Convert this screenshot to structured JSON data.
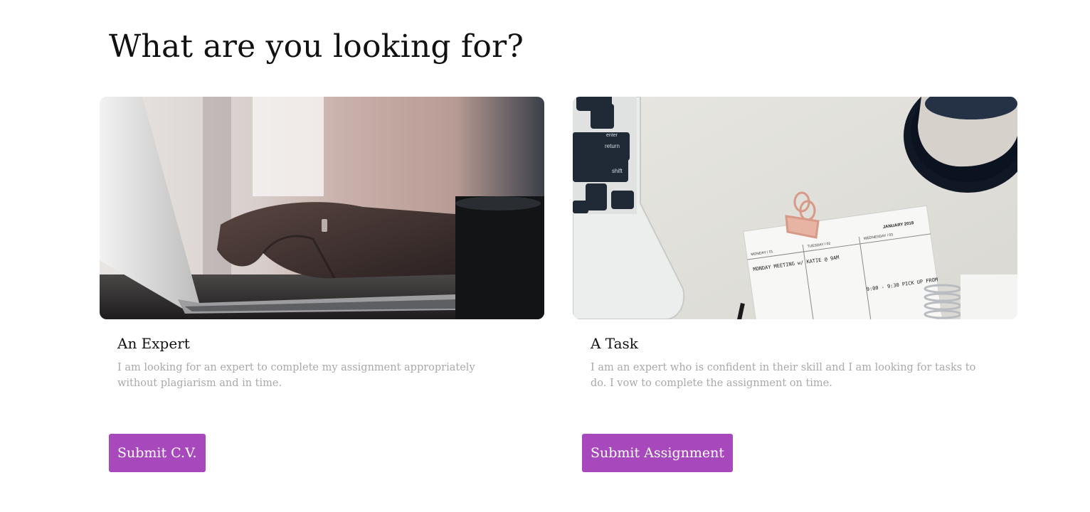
{
  "heading": "What are you looking for?",
  "cards": [
    {
      "title": "An Expert",
      "description": "I am looking for an expert to complete my assignment appropriately without plagiarism and in time.",
      "button_label": "Submit C.V."
    },
    {
      "title": "A Task",
      "description": "I am an expert who is confident in their skill and I am looking for tasks to do. I vow to complete the assignment on time.",
      "button_label": "Submit Assignment",
      "photo_text": {
        "key_enter": "enter",
        "key_return": "return",
        "key_shift": "shift",
        "planner_day_1": "MONDAY / 01",
        "planner_day_2": "TUESDAY / 02",
        "planner_day_3": "WEDNESDAY / 03",
        "planner_month": "JANUARY 2018",
        "note_1": "MONDAY MEETING w/ KATIE @ 9AM",
        "note_2": "9:00 - 9:30 PICK UP FROM"
      }
    }
  ],
  "colors": {
    "button": "#a848bd",
    "description": "#a9a9a9"
  }
}
